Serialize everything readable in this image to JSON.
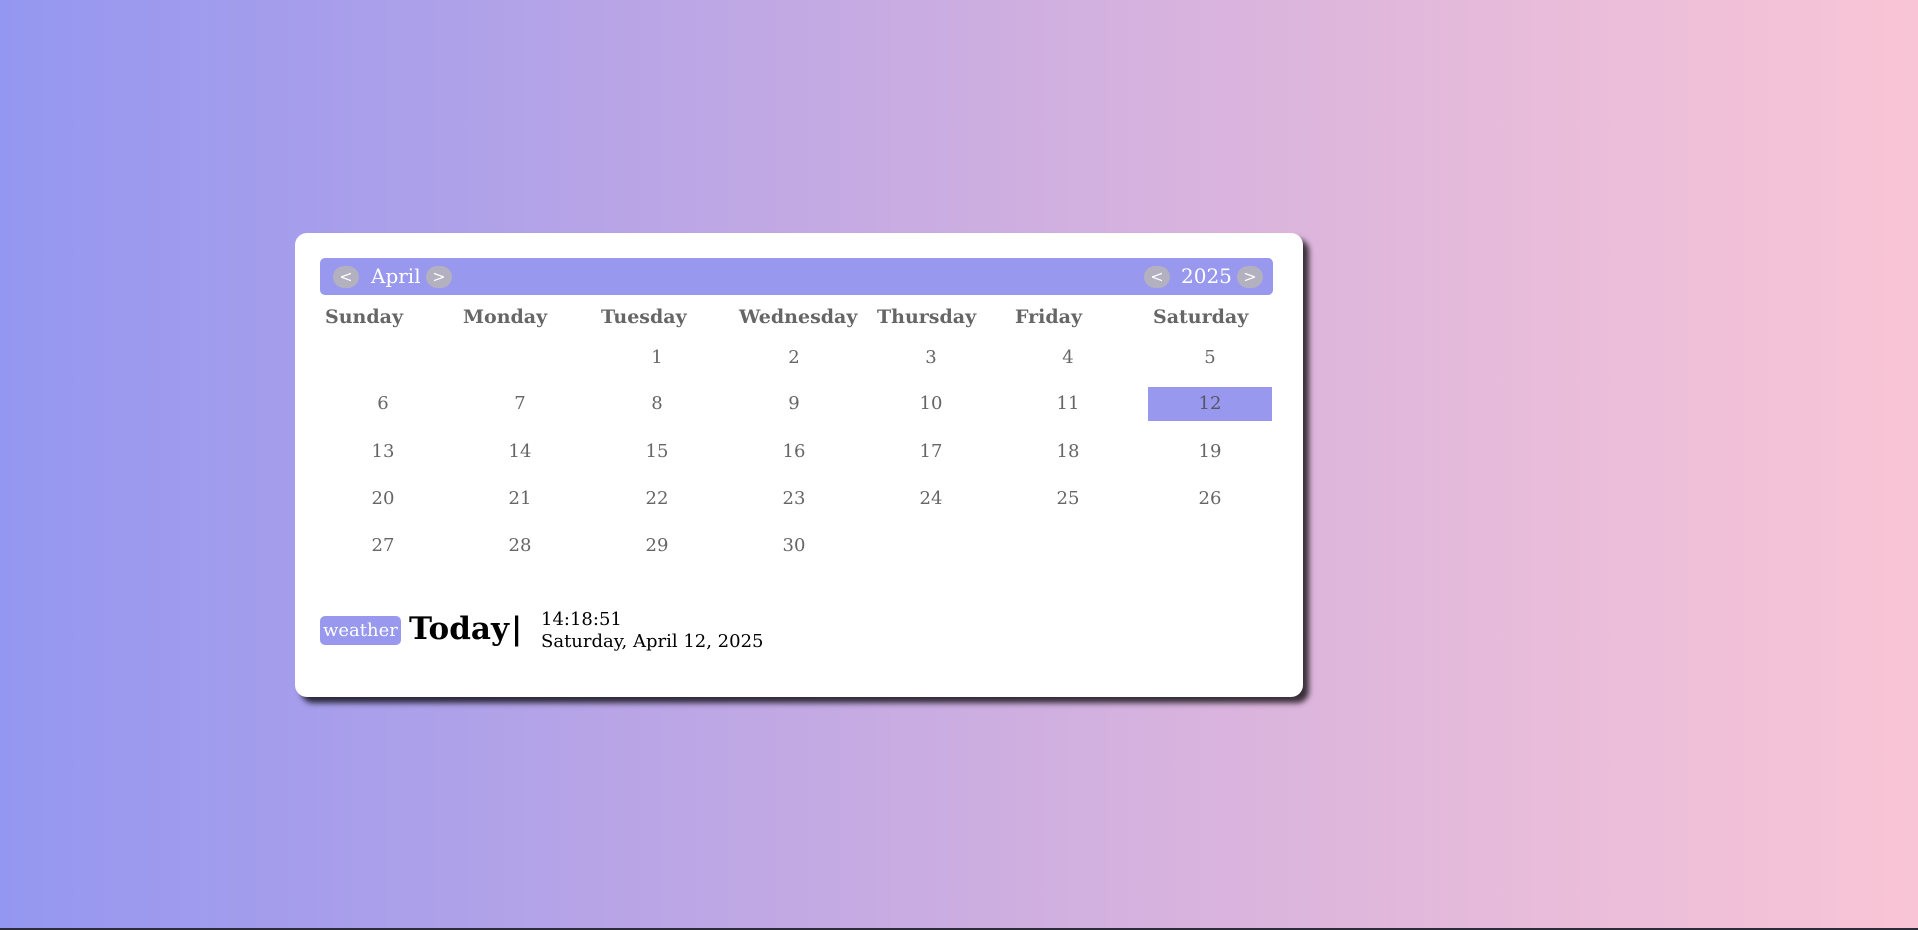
{
  "calendar": {
    "month": {
      "prev_label": "<",
      "name": "April",
      "next_label": ">"
    },
    "year": {
      "prev_label": "<",
      "value": "2025",
      "next_label": ">"
    },
    "weekdays": [
      "Sunday",
      "Monday",
      "Tuesday",
      "Wednesday",
      "Thursday",
      "Friday",
      "Saturday"
    ],
    "weeks": [
      [
        "",
        "",
        "1",
        "2",
        "3",
        "4",
        "5"
      ],
      [
        "6",
        "7",
        "8",
        "9",
        "10",
        "11",
        "12"
      ],
      [
        "13",
        "14",
        "15",
        "16",
        "17",
        "18",
        "19"
      ],
      [
        "20",
        "21",
        "22",
        "23",
        "24",
        "25",
        "26"
      ],
      [
        "27",
        "28",
        "29",
        "30",
        "",
        "",
        ""
      ]
    ],
    "selected_day": "12"
  },
  "today": {
    "weather_label": "weather",
    "label": "Today",
    "separator": "|",
    "time": "14:18:51",
    "date": "Saturday, April 12, 2025"
  },
  "colors": {
    "accent": "#9798ee",
    "nav_button": "#b3b0bf",
    "text_muted": "#666666",
    "background_start": "#9497f1",
    "background_end": "#f9c5d6"
  }
}
